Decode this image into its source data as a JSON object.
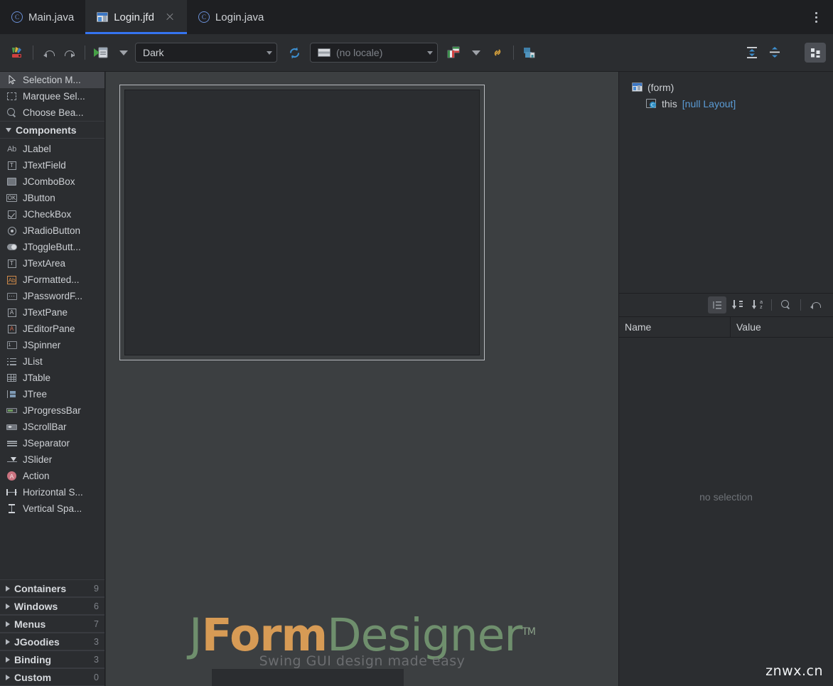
{
  "window": {
    "title": "JFormDesigner"
  },
  "tabs": [
    {
      "label": "Main.java",
      "icon": "java-class-icon",
      "active": false,
      "closable": false
    },
    {
      "label": "Login.jfd",
      "icon": "jformdesigner-file-icon",
      "active": true,
      "closable": true
    },
    {
      "label": "Login.java",
      "icon": "java-class-icon",
      "active": false,
      "closable": false
    }
  ],
  "tabbar": {
    "overflow_menu": "more-options"
  },
  "toolbar": {
    "palette_button": "Palette",
    "undo_label": "Undo",
    "redo_label": "Redo",
    "preview_label": "Test Form",
    "preview_dropdown": "Test Form Options",
    "laf_select": {
      "value": "Dark",
      "label": "Look and Feel"
    },
    "refresh_label": "Refresh",
    "locale_select": {
      "value": "(no locale)",
      "label": "Locale"
    },
    "i18n_label": "Externalize Strings",
    "i18n_dropdown": "Localization Options",
    "link_label": "Link Selection",
    "export_label": "Export Layout",
    "align_vertical_center": "Center Vertically",
    "align_top": "Align Top",
    "grid_toggle": "Show Grid"
  },
  "palette": {
    "tools": [
      {
        "label": "Selection M...",
        "icon": "cursor-icon",
        "selected": true
      },
      {
        "label": "Marquee Sel...",
        "icon": "marquee-icon",
        "selected": false
      },
      {
        "label": "Choose Bea...",
        "icon": "choose-bean-icon",
        "selected": false
      }
    ],
    "groups": [
      {
        "label": "Components",
        "expanded": true,
        "count": ""
      },
      {
        "label": "Containers",
        "expanded": false,
        "count": "9"
      },
      {
        "label": "Windows",
        "expanded": false,
        "count": "6"
      },
      {
        "label": "Menus",
        "expanded": false,
        "count": "7"
      },
      {
        "label": "JGoodies",
        "expanded": false,
        "count": "3"
      },
      {
        "label": "Binding",
        "expanded": false,
        "count": "3"
      },
      {
        "label": "Custom",
        "expanded": false,
        "count": "0"
      }
    ],
    "components": [
      {
        "label": "JLabel",
        "icon": "jlabel-icon"
      },
      {
        "label": "JTextField",
        "icon": "jtextfield-icon"
      },
      {
        "label": "JComboBox",
        "icon": "jcombobox-icon"
      },
      {
        "label": "JButton",
        "icon": "jbutton-icon"
      },
      {
        "label": "JCheckBox",
        "icon": "jcheckbox-icon"
      },
      {
        "label": "JRadioButton",
        "icon": "jradiobutton-icon"
      },
      {
        "label": "JToggleButt...",
        "icon": "jtogglebutton-icon"
      },
      {
        "label": "JTextArea",
        "icon": "jtextarea-icon"
      },
      {
        "label": "JFormatted...",
        "icon": "jformattedtextfield-icon"
      },
      {
        "label": "JPasswordF...",
        "icon": "jpasswordfield-icon"
      },
      {
        "label": "JTextPane",
        "icon": "jtextpane-icon"
      },
      {
        "label": "JEditorPane",
        "icon": "jeditorpane-icon"
      },
      {
        "label": "JSpinner",
        "icon": "jspinner-icon"
      },
      {
        "label": "JList",
        "icon": "jlist-icon"
      },
      {
        "label": "JTable",
        "icon": "jtable-icon"
      },
      {
        "label": "JTree",
        "icon": "jtree-icon"
      },
      {
        "label": "JProgressBar",
        "icon": "jprogressbar-icon"
      },
      {
        "label": "JScrollBar",
        "icon": "jscrollbar-icon"
      },
      {
        "label": "JSeparator",
        "icon": "jseparator-icon"
      },
      {
        "label": "JSlider",
        "icon": "jslider-icon"
      },
      {
        "label": "Action",
        "icon": "action-icon"
      },
      {
        "label": "Horizontal S...",
        "icon": "horizontal-strut-icon"
      },
      {
        "label": "Vertical Spa...",
        "icon": "vertical-strut-icon"
      }
    ]
  },
  "designer": {
    "logo": {
      "part_j": "J",
      "part_form": "Form",
      "part_designer": "Designer",
      "trademark": "TM",
      "tagline": "Swing GUI design made easy"
    }
  },
  "structure": {
    "rows": [
      {
        "label": "(form)",
        "icon": "form-icon",
        "suffix": "",
        "indent": 1
      },
      {
        "label": "this",
        "icon": "this-component-icon",
        "suffix": "[null Layout]",
        "indent": 2
      }
    ]
  },
  "properties": {
    "toolbar": {
      "group_by_category": "Group by Category",
      "sort_by_definition": "Sort by Definition Order",
      "sort_alphabetically": "Sort Alphabetically",
      "search": "Find Property",
      "restore_default": "Restore Default Value"
    },
    "columns": {
      "name": "Name",
      "value": "Value"
    },
    "empty_message": "no selection"
  },
  "watermark": {
    "text": "znwx.cn"
  },
  "colors": {
    "accent": "#3574f0",
    "panel_bg": "#2b2d30",
    "tabbar_bg": "#1e1f22",
    "canvas_bg": "#3c3f41",
    "text": "#cdd0d4",
    "muted_text": "#7e8289",
    "logo_green": "#6f8f6d",
    "logo_orange": "#d79b55",
    "link_blue": "#5b9cd6"
  }
}
